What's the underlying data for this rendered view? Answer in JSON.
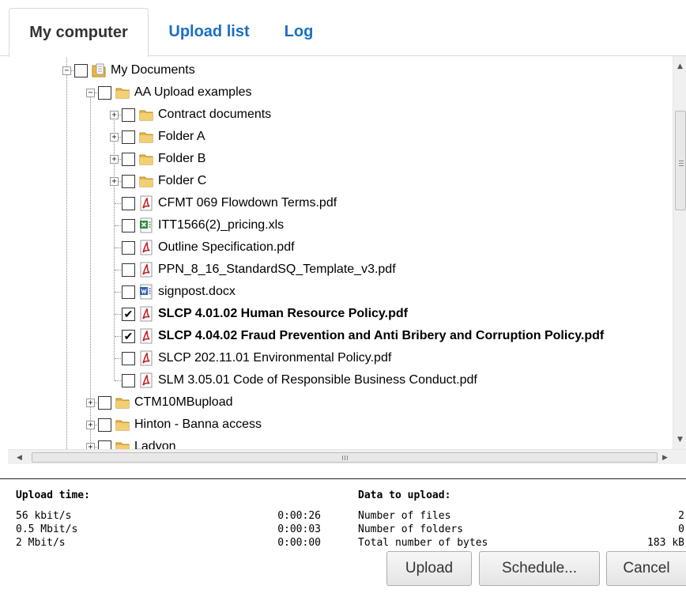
{
  "tabs": [
    {
      "label": "My computer",
      "active": true
    },
    {
      "label": "Upload list",
      "active": false
    },
    {
      "label": "Log",
      "active": false
    }
  ],
  "tree": [
    {
      "label": "My Documents",
      "level": 0,
      "expander": "-",
      "icon": "documents-folder-icon",
      "checked": false,
      "bold": false
    },
    {
      "label": "AA Upload examples",
      "level": 1,
      "expander": "-",
      "icon": "folder-icon",
      "checked": false,
      "bold": false
    },
    {
      "label": "Contract documents",
      "level": 2,
      "expander": "+",
      "icon": "folder-icon",
      "checked": false,
      "bold": false
    },
    {
      "label": "Folder A",
      "level": 2,
      "expander": "+",
      "icon": "folder-icon",
      "checked": false,
      "bold": false
    },
    {
      "label": "Folder B",
      "level": 2,
      "expander": "+",
      "icon": "folder-icon",
      "checked": false,
      "bold": false
    },
    {
      "label": "Folder C",
      "level": 2,
      "expander": "+",
      "icon": "folder-icon",
      "checked": false,
      "bold": false
    },
    {
      "label": "CFMT 069 Flowdown Terms.pdf",
      "level": 2,
      "expander": "",
      "icon": "pdf-icon",
      "checked": false,
      "bold": false
    },
    {
      "label": "ITT1566(2)_pricing.xls",
      "level": 2,
      "expander": "",
      "icon": "excel-icon",
      "checked": false,
      "bold": false
    },
    {
      "label": "Outline Specification.pdf",
      "level": 2,
      "expander": "",
      "icon": "pdf-icon",
      "checked": false,
      "bold": false
    },
    {
      "label": "PPN_8_16_StandardSQ_Template_v3.pdf",
      "level": 2,
      "expander": "",
      "icon": "pdf-icon",
      "checked": false,
      "bold": false
    },
    {
      "label": "signpost.docx",
      "level": 2,
      "expander": "",
      "icon": "word-icon",
      "checked": false,
      "bold": false
    },
    {
      "label": "SLCP 4.01.02 Human Resource Policy.pdf",
      "level": 2,
      "expander": "",
      "icon": "pdf-icon",
      "checked": true,
      "bold": true
    },
    {
      "label": "SLCP 4.04.02 Fraud Prevention and Anti Bribery and Corruption Policy.pdf",
      "level": 2,
      "expander": "",
      "icon": "pdf-icon",
      "checked": true,
      "bold": true
    },
    {
      "label": "SLCP 202.11.01 Environmental Policy.pdf",
      "level": 2,
      "expander": "",
      "icon": "pdf-icon",
      "checked": false,
      "bold": false
    },
    {
      "label": "SLM 3.05.01 Code of Responsible Business Conduct.pdf",
      "level": 2,
      "expander": "",
      "icon": "pdf-icon",
      "checked": false,
      "bold": false
    },
    {
      "label": "CTM10MBupload",
      "level": 1,
      "expander": "+",
      "icon": "folder-icon",
      "checked": false,
      "bold": false
    },
    {
      "label": "Hinton - Banna access",
      "level": 1,
      "expander": "+",
      "icon": "folder-icon",
      "checked": false,
      "bold": false
    },
    {
      "label": "Ladyon",
      "level": 1,
      "expander": "+",
      "icon": "folder-icon",
      "checked": false,
      "bold": false
    }
  ],
  "upload_time": {
    "heading": "Upload time:",
    "rows": [
      {
        "label": "56 kbit/s",
        "value": "0:00:26"
      },
      {
        "label": "0.5 Mbit/s",
        "value": "0:00:03"
      },
      {
        "label": "2 Mbit/s",
        "value": "0:00:00"
      }
    ]
  },
  "data_to_upload": {
    "heading": "Data to upload:",
    "rows": [
      {
        "label": "Number of files",
        "value": "2"
      },
      {
        "label": "Number of folders",
        "value": "0"
      },
      {
        "label": "Total number of bytes",
        "value": "183 kB"
      }
    ]
  },
  "buttons": {
    "upload": "Upload",
    "schedule": "Schedule...",
    "cancel": "Cancel"
  },
  "colors": {
    "tab_link": "#1a6fc4",
    "folder": "#e8b64a",
    "pdf": "#c4262e",
    "excel": "#2e8b3e",
    "word": "#2f5fb0"
  }
}
